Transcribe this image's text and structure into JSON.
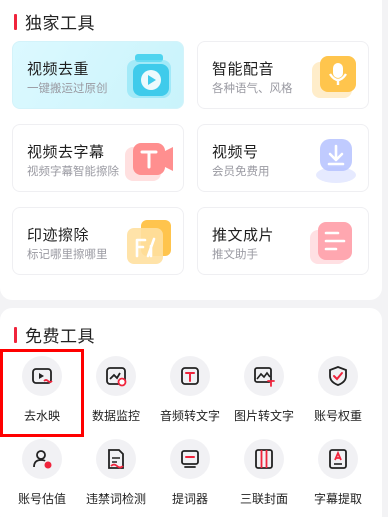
{
  "exclusive": {
    "title": "独家工具",
    "cards": [
      {
        "title": "视频去重",
        "subtitle": "一键搬运过原创",
        "icon": "play-video-icon"
      },
      {
        "title": "智能配音",
        "subtitle": "各种语气、风格",
        "icon": "microphone-icon"
      },
      {
        "title": "视频去字幕",
        "subtitle": "视频字幕智能擦除",
        "icon": "text-t-icon"
      },
      {
        "title": "视频号",
        "subtitle": "会员免费用",
        "icon": "download-icon"
      },
      {
        "title": "印迹擦除",
        "subtitle": "标记哪里擦哪里",
        "icon": "eraser-brush-icon"
      },
      {
        "title": "推文成片",
        "subtitle": "推文助手",
        "icon": "document-lines-icon"
      }
    ]
  },
  "free": {
    "title": "免费工具",
    "tools": [
      {
        "label": "去水映",
        "icon": "remove-watermark-icon"
      },
      {
        "label": "数据监控",
        "icon": "data-monitor-icon"
      },
      {
        "label": "音频转文字",
        "icon": "audio-to-text-icon"
      },
      {
        "label": "图片转文字",
        "icon": "image-to-text-icon"
      },
      {
        "label": "账号权重",
        "icon": "shield-check-icon"
      },
      {
        "label": "账号估值",
        "icon": "account-value-icon"
      },
      {
        "label": "违禁词检测",
        "icon": "forbidden-word-icon"
      },
      {
        "label": "提词器",
        "icon": "teleprompter-icon"
      },
      {
        "label": "三联封面",
        "icon": "triptych-cover-icon"
      },
      {
        "label": "字幕提取",
        "icon": "subtitle-extract-icon"
      }
    ]
  },
  "colors": {
    "accent": "#f0243c",
    "selection_outline": "#ff0000",
    "card_highlight": "#d4f6fd",
    "background": "#f3f3f5"
  }
}
